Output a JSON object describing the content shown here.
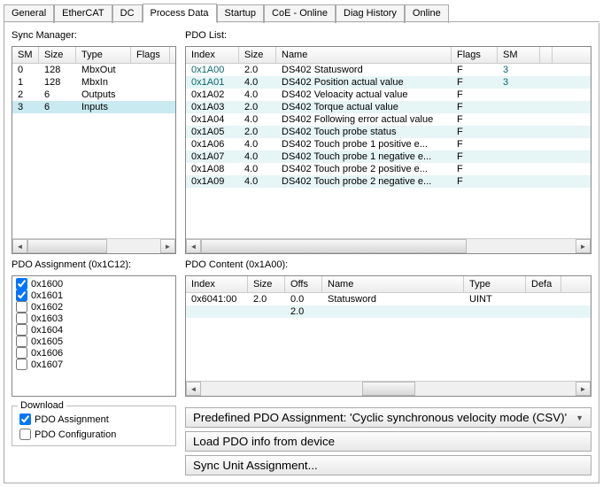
{
  "tabs": [
    "General",
    "EtherCAT",
    "DC",
    "Process Data",
    "Startup",
    "CoE - Online",
    "Diag History",
    "Online"
  ],
  "active_tab": 3,
  "sync_manager": {
    "title": "Sync Manager:",
    "headers": [
      "SM",
      "Size",
      "Type",
      "Flags"
    ],
    "rows": [
      {
        "sm": "0",
        "size": "128",
        "type": "MbxOut",
        "flags": ""
      },
      {
        "sm": "1",
        "size": "128",
        "type": "MbxIn",
        "flags": ""
      },
      {
        "sm": "2",
        "size": "6",
        "type": "Outputs",
        "flags": ""
      },
      {
        "sm": "3",
        "size": "6",
        "type": "Inputs",
        "flags": ""
      }
    ],
    "selected": 3
  },
  "pdo_list": {
    "title": "PDO List:",
    "headers": [
      "Index",
      "Size",
      "Name",
      "Flags",
      "SM",
      ""
    ],
    "rows": [
      {
        "index": "0x1A00",
        "size": "2.0",
        "name": "DS402 Statusword",
        "flags": "F",
        "sm": "3"
      },
      {
        "index": "0x1A01",
        "size": "4.0",
        "name": "DS402 Position actual value",
        "flags": "F",
        "sm": "3"
      },
      {
        "index": "0x1A02",
        "size": "4.0",
        "name": "DS402 Veloacity actual value",
        "flags": "F",
        "sm": ""
      },
      {
        "index": "0x1A03",
        "size": "2.0",
        "name": "DS402 Torque actual value",
        "flags": "F",
        "sm": ""
      },
      {
        "index": "0x1A04",
        "size": "4.0",
        "name": "DS402 Following error actual value",
        "flags": "F",
        "sm": ""
      },
      {
        "index": "0x1A05",
        "size": "2.0",
        "name": "DS402 Touch probe status",
        "flags": "F",
        "sm": ""
      },
      {
        "index": "0x1A06",
        "size": "4.0",
        "name": "DS402 Touch probe 1 positive e...",
        "flags": "F",
        "sm": ""
      },
      {
        "index": "0x1A07",
        "size": "4.0",
        "name": "DS402 Touch probe 1 negative e...",
        "flags": "F",
        "sm": ""
      },
      {
        "index": "0x1A08",
        "size": "4.0",
        "name": "DS402 Touch probe 2 positive e...",
        "flags": "F",
        "sm": ""
      },
      {
        "index": "0x1A09",
        "size": "4.0",
        "name": "DS402 Touch probe 2 negative e...",
        "flags": "F",
        "sm": ""
      }
    ]
  },
  "pdo_assignment": {
    "title": "PDO Assignment (0x1C12):",
    "items": [
      {
        "label": "0x1600",
        "checked": true
      },
      {
        "label": "0x1601",
        "checked": true
      },
      {
        "label": "0x1602",
        "checked": false
      },
      {
        "label": "0x1603",
        "checked": false
      },
      {
        "label": "0x1604",
        "checked": false
      },
      {
        "label": "0x1605",
        "checked": false
      },
      {
        "label": "0x1606",
        "checked": false
      },
      {
        "label": "0x1607",
        "checked": false
      }
    ]
  },
  "pdo_content": {
    "title": "PDO Content (0x1A00):",
    "headers": [
      "Index",
      "Size",
      "Offs",
      "Name",
      "Type",
      "Defa"
    ],
    "rows": [
      {
        "index": "0x6041:00",
        "size": "2.0",
        "offs": "0.0",
        "name": "Statusword",
        "type": "UINT",
        "defa": ""
      },
      {
        "index": "",
        "size": "",
        "offs": "2.0",
        "name": "",
        "type": "",
        "defa": ""
      }
    ]
  },
  "download": {
    "legend": "Download",
    "pdo_assignment_label": "PDO Assignment",
    "pdo_assignment_checked": true,
    "pdo_config_label": "PDO Configuration",
    "pdo_config_checked": false
  },
  "buttons": {
    "predefined": "Predefined PDO Assignment: 'Cyclic synchronous velocity mode (CSV)'",
    "load": "Load PDO info from device",
    "syncunit": "Sync Unit Assignment..."
  }
}
